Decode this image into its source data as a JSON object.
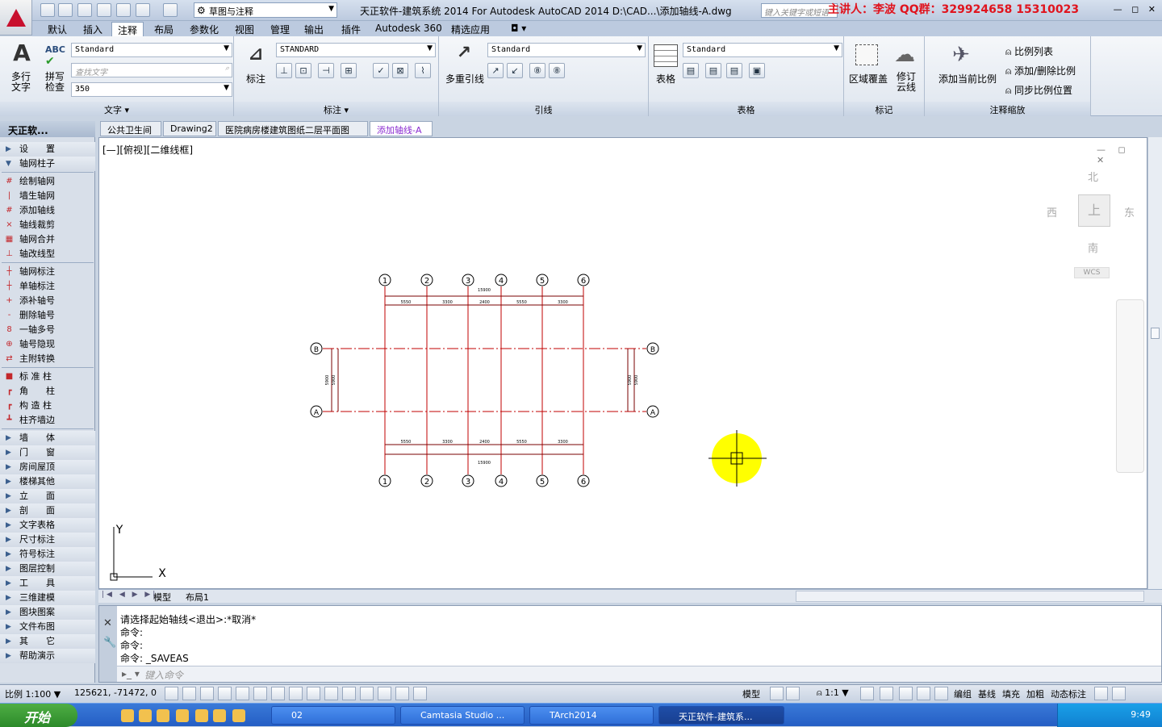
{
  "titlebar": {
    "workspace": "草图与注释",
    "doc_title": "天正软件-建筑系统 2014  For Autodesk AutoCAD 2014    D:\\CAD...\\添加轴线-A.dwg",
    "search_placeholder": "键入关键字或短语",
    "overlay": "主讲人：李波    QQ群：329924658   15310023"
  },
  "menu": [
    "默认",
    "插入",
    "注释",
    "布局",
    "参数化",
    "视图",
    "管理",
    "输出",
    "插件",
    "Autodesk 360",
    "精选应用"
  ],
  "menu_active": "注释",
  "ribbon": {
    "text_panel": {
      "title": "文字",
      "mtext": "多行\n文字",
      "spell": "拼写\n检查",
      "style": "Standard",
      "find_placeholder": "查找文字",
      "height": "350"
    },
    "dim_panel": {
      "title": "标注",
      "big_label": "标注",
      "style": "STANDARD"
    },
    "leader_panel": {
      "title": "引线",
      "big_label": "多重引线",
      "style": "Standard"
    },
    "table_panel": {
      "title": "表格",
      "big_label": "表格",
      "style": "Standard"
    },
    "markup_panel": {
      "title": "标记",
      "wipeout": "区域覆盖",
      "revcloud": "修订\n云线"
    },
    "scale_panel": {
      "title": "注释缩放",
      "add_current": "添加当前比例",
      "scale_list": "比例列表",
      "add_delete": "添加/删除比例",
      "sync": "同步比例位置"
    }
  },
  "palette": {
    "title": "天正软...",
    "items": [
      {
        "label": "设　　置",
        "type": "group"
      },
      {
        "label": "轴网柱子",
        "type": "group-open"
      },
      {
        "label": "绘制轴网",
        "icon": "#"
      },
      {
        "label": "墙生轴网",
        "icon": "|"
      },
      {
        "label": "添加轴线",
        "icon": "#"
      },
      {
        "label": "轴线裁剪",
        "icon": "×"
      },
      {
        "label": "轴网合并",
        "icon": "▦"
      },
      {
        "label": "轴改线型",
        "icon": "⊥"
      },
      {
        "label": "轴网标注",
        "icon": "┼"
      },
      {
        "label": "单轴标注",
        "icon": "┼"
      },
      {
        "label": "添补轴号",
        "icon": "+"
      },
      {
        "label": "删除轴号",
        "icon": "-"
      },
      {
        "label": "一轴多号",
        "icon": "8"
      },
      {
        "label": "轴号隐现",
        "icon": "⊕"
      },
      {
        "label": "主附转换",
        "icon": "⇄"
      },
      {
        "label": "标 准 柱",
        "icon": "■"
      },
      {
        "label": "角　　柱",
        "icon": "┏"
      },
      {
        "label": "构 造 柱",
        "icon": "┏"
      },
      {
        "label": "柱齐墙边",
        "icon": "┻"
      },
      {
        "label": "墙　　体",
        "type": "group"
      },
      {
        "label": "门　　窗",
        "type": "group"
      },
      {
        "label": "房间屋顶",
        "type": "group"
      },
      {
        "label": "楼梯其他",
        "type": "group"
      },
      {
        "label": "立　　面",
        "type": "group"
      },
      {
        "label": "剖　　面",
        "type": "group"
      },
      {
        "label": "文字表格",
        "type": "group"
      },
      {
        "label": "尺寸标注",
        "type": "group"
      },
      {
        "label": "符号标注",
        "type": "group"
      },
      {
        "label": "图层控制",
        "type": "group"
      },
      {
        "label": "工　　具",
        "type": "group"
      },
      {
        "label": "三维建模",
        "type": "group"
      },
      {
        "label": "图块图案",
        "type": "group"
      },
      {
        "label": "文件布图",
        "type": "group"
      },
      {
        "label": "其　　它",
        "type": "group"
      },
      {
        "label": "帮助演示",
        "type": "group"
      }
    ]
  },
  "doctabs": [
    "公共卫生间",
    "Drawing2",
    "医院病房楼建筑图纸二层平面图",
    "添加轴线-A"
  ],
  "doctab_active": 3,
  "canvas": {
    "view_label": "[—][俯视][二维线框]",
    "viewcube": {
      "n": "北",
      "s": "南",
      "e": "东",
      "w": "西",
      "top": "上",
      "wcs": "WCS"
    },
    "ucs_x": "X",
    "ucs_y": "Y"
  },
  "drawing": {
    "axis_numbers": [
      "1",
      "2",
      "3",
      "4",
      "5",
      "6"
    ],
    "axis_letters": [
      "B",
      "A"
    ],
    "dims_top": [
      "5550",
      "3300",
      "2400",
      "5550",
      "3300"
    ],
    "total_top": "15900",
    "dims_bottom": [
      "5550",
      "3300",
      "2400",
      "5550",
      "3300"
    ],
    "total_bottom": "15900",
    "dim_side": "5900",
    "colors": {
      "axis": "#c00000",
      "dim": "#7a0000",
      "text": "#000000"
    }
  },
  "layouttabs": [
    "模型",
    "布局1"
  ],
  "command": {
    "lines": [
      "请选择起始轴线<退出>:*取消*",
      "命令:",
      "命令:",
      "命令:  _SAVEAS"
    ],
    "input_placeholder": "键入命令"
  },
  "status": {
    "scale": "比例 1:100",
    "coords": "125621, -71472, 0",
    "model": "模型",
    "anno_scale": "1:1",
    "toggles": [
      "编组",
      "基线",
      "填充",
      "加粗",
      "动态标注"
    ]
  },
  "taskbar": {
    "start": "开始",
    "tasks": [
      "02",
      "Camtasia Studio ...",
      "TArch2014",
      "天正软件-建筑系..."
    ],
    "clock": "9:49"
  }
}
